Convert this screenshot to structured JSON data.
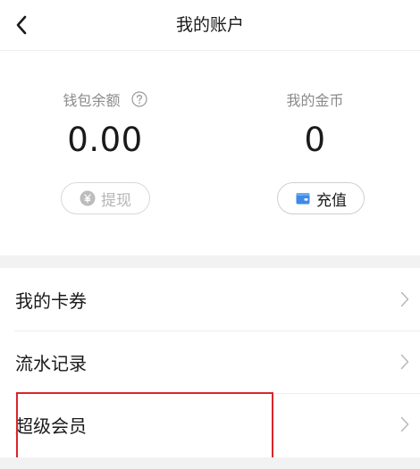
{
  "header": {
    "title": "我的账户",
    "back_icon": "chevron-left-icon"
  },
  "balance": {
    "wallet": {
      "label": "钱包余额",
      "value": "0.00",
      "help_icon": "question-circle-icon",
      "button_label": "提现",
      "button_icon": "yen-circle-icon",
      "button_enabled": false
    },
    "coins": {
      "label": "我的金币",
      "value": "0",
      "button_label": "充值",
      "button_icon": "wallet-icon",
      "button_icon_color": "#3d8ae8"
    }
  },
  "menu": {
    "items": [
      {
        "label": "我的卡券",
        "icon": "chevron-right-icon"
      },
      {
        "label": "流水记录",
        "icon": "chevron-right-icon"
      },
      {
        "label": "超级会员",
        "icon": "chevron-right-icon",
        "highlighted": true
      }
    ]
  },
  "colors": {
    "highlight": "#d9262c",
    "separator_band": "#f2f2f2",
    "muted_text": "#8a8a8a"
  }
}
